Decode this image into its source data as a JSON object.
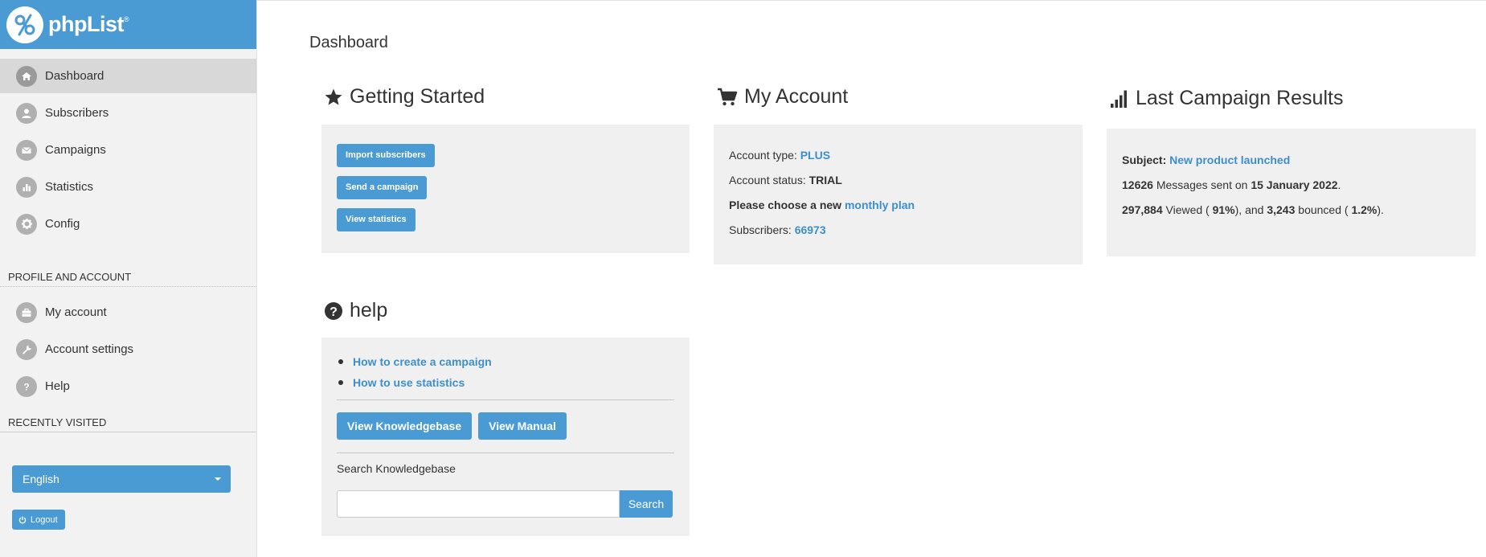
{
  "app": {
    "logo_text": "phpList",
    "logo_mark": "®"
  },
  "sidebar": {
    "items": [
      {
        "label": "Dashboard",
        "icon": "home-icon"
      },
      {
        "label": "Subscribers",
        "icon": "user-icon"
      },
      {
        "label": "Campaigns",
        "icon": "envelope-icon"
      },
      {
        "label": "Statistics",
        "icon": "bar-chart-icon"
      },
      {
        "label": "Config",
        "icon": "gear-icon"
      }
    ],
    "profile_heading": "PROFILE AND ACCOUNT",
    "profile_items": [
      {
        "label": "My account",
        "icon": "briefcase-icon"
      },
      {
        "label": "Account settings",
        "icon": "wrench-icon"
      },
      {
        "label": "Help",
        "icon": "question-icon"
      }
    ],
    "recent_heading": "RECENTLY VISITED",
    "language": "English",
    "logout_label": "Logout"
  },
  "main": {
    "title": "Dashboard",
    "getting_started": {
      "heading": "Getting Started",
      "buttons": [
        "Import subscribers",
        "Send a campaign",
        "View statistics"
      ]
    },
    "my_account": {
      "heading": "My Account",
      "type_label": "Account type:",
      "type_value": "PLUS",
      "status_label": "Account status:",
      "status_value": "TRIAL",
      "plan_prompt": "Please choose a new",
      "plan_link": "monthly plan",
      "subs_label": "Subscribers:",
      "subs_value": "66973"
    },
    "last_campaign": {
      "heading": "Last Campaign Results",
      "subject_label": "Subject:",
      "subject_value": "New product launched",
      "sent_count": "12626",
      "sent_text": "Messages sent on",
      "sent_date": "15 January 2022",
      "period": ".",
      "viewed_count": "297,884",
      "viewed_text": "Viewed (",
      "viewed_pct": "91%",
      "and_text": "), and",
      "bounced_count": "3,243",
      "bounced_text": "bounced (",
      "bounced_pct": "1.2%",
      "end_text": ")."
    },
    "help": {
      "heading": "help",
      "links": [
        "How to create a campaign",
        "How to use statistics"
      ],
      "kb_button": "View Knowledgebase",
      "manual_button": "View Manual",
      "search_label": "Search Knowledgebase",
      "search_placeholder": "",
      "search_button": "Search"
    }
  },
  "colors": {
    "accent": "#4a9bd4",
    "link": "#3d8fcc",
    "panel": "#f0f0f0",
    "sidebar": "#f2f2f2"
  }
}
